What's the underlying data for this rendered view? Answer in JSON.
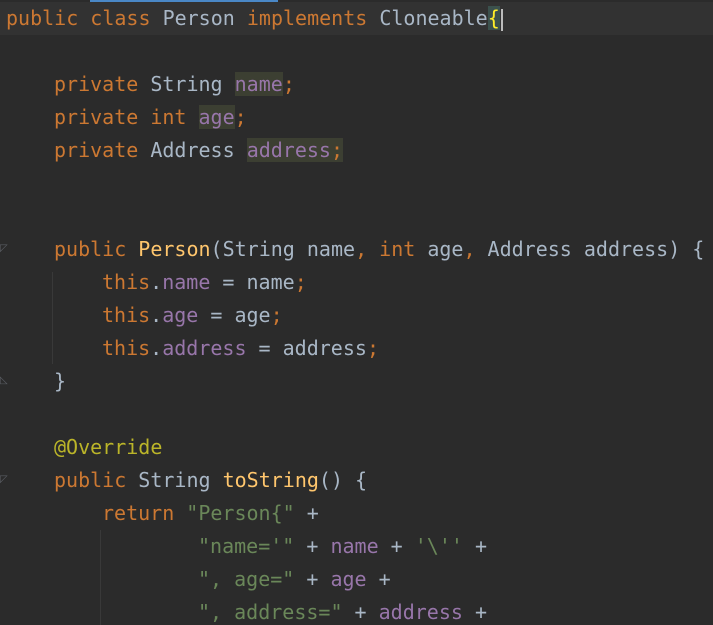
{
  "code": {
    "l1": {
      "kw1": "public",
      "kw2": "class",
      "name": "Person",
      "kw3": "implements",
      "iface": "Cloneable",
      "brace": "{"
    },
    "l3": {
      "mod": "private",
      "type": "String",
      "field": "name",
      "semi": ";"
    },
    "l4": {
      "mod": "private",
      "type": "int",
      "field": "age",
      "semi": ";"
    },
    "l5": {
      "mod": "private",
      "type": "Address",
      "field": "address",
      "semi": ";"
    },
    "l8": {
      "mod": "public",
      "ctor": "Person",
      "open": "(",
      "t1": "String",
      "p1": "name",
      "c1": ",",
      "t2": "int",
      "p2": "age",
      "c2": ",",
      "t3": "Address",
      "p3": "address",
      "close": ") {"
    },
    "l9": {
      "this": "this",
      "dot": ".",
      "field": "name",
      "eq": " = ",
      "val": "name",
      "semi": ";"
    },
    "l10": {
      "this": "this",
      "dot": ".",
      "field": "age",
      "eq": " = ",
      "val": "age",
      "semi": ";"
    },
    "l11": {
      "this": "this",
      "dot": ".",
      "field": "address",
      "eq": " = ",
      "val": "address",
      "semi": ";"
    },
    "l12": {
      "brace": "}"
    },
    "l14": {
      "ann": "@Override"
    },
    "l15": {
      "mod": "public",
      "type": "String",
      "fn": "toString",
      "rest": "() {"
    },
    "l16": {
      "kw": "return",
      "str": "\"Person{\"",
      "plus": " +"
    },
    "l17": {
      "str1": "\"name='\"",
      "p1": " + ",
      "field": "name",
      "p2": " + ",
      "str2": "'\\''",
      "p3": " +"
    },
    "l18": {
      "str1": "\", age=\"",
      "p1": " + ",
      "field": "age",
      "p2": " +"
    },
    "l19": {
      "str1": "\", address=\"",
      "p1": " + ",
      "field": "address",
      "p2": " +"
    }
  }
}
